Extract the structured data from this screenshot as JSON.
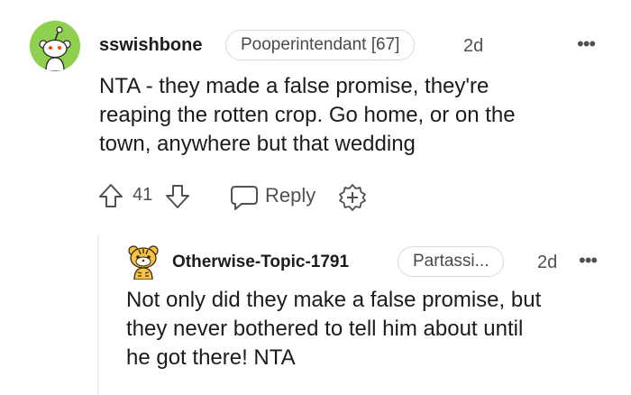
{
  "colors": {
    "avatar_bg": "#8fd14f",
    "text_primary": "#1c1c1c",
    "text_meta": "#505050",
    "pill_border": "#d8dadc",
    "thread_line": "#edeff1"
  },
  "comment": {
    "avatar_icon": "reddit-snoo-avatar",
    "username": "sswishbone",
    "flair": "Pooperintendant [67]",
    "age": "2d",
    "more": "•••",
    "body_lines": [
      "NTA - they made a false promise, they're",
      "reaping the rotten crop. Go home, or on the",
      "town, anywhere but that wedding"
    ],
    "votes": "41",
    "reply_label": "Reply",
    "upvote_icon": "upvote-arrow-icon",
    "downvote_icon": "downvote-arrow-icon",
    "reply_icon": "speech-bubble-icon",
    "award_icon": "add-award-icon"
  },
  "reply": {
    "avatar_icon": "tiger-avatar",
    "username": "Otherwise-Topic-1791",
    "flair": "Partassi...",
    "age": "2d",
    "more": "•••",
    "body_lines": [
      "Not only did they make a false promise, but",
      "they never bothered to tell him about until",
      "he got there! NTA"
    ]
  }
}
